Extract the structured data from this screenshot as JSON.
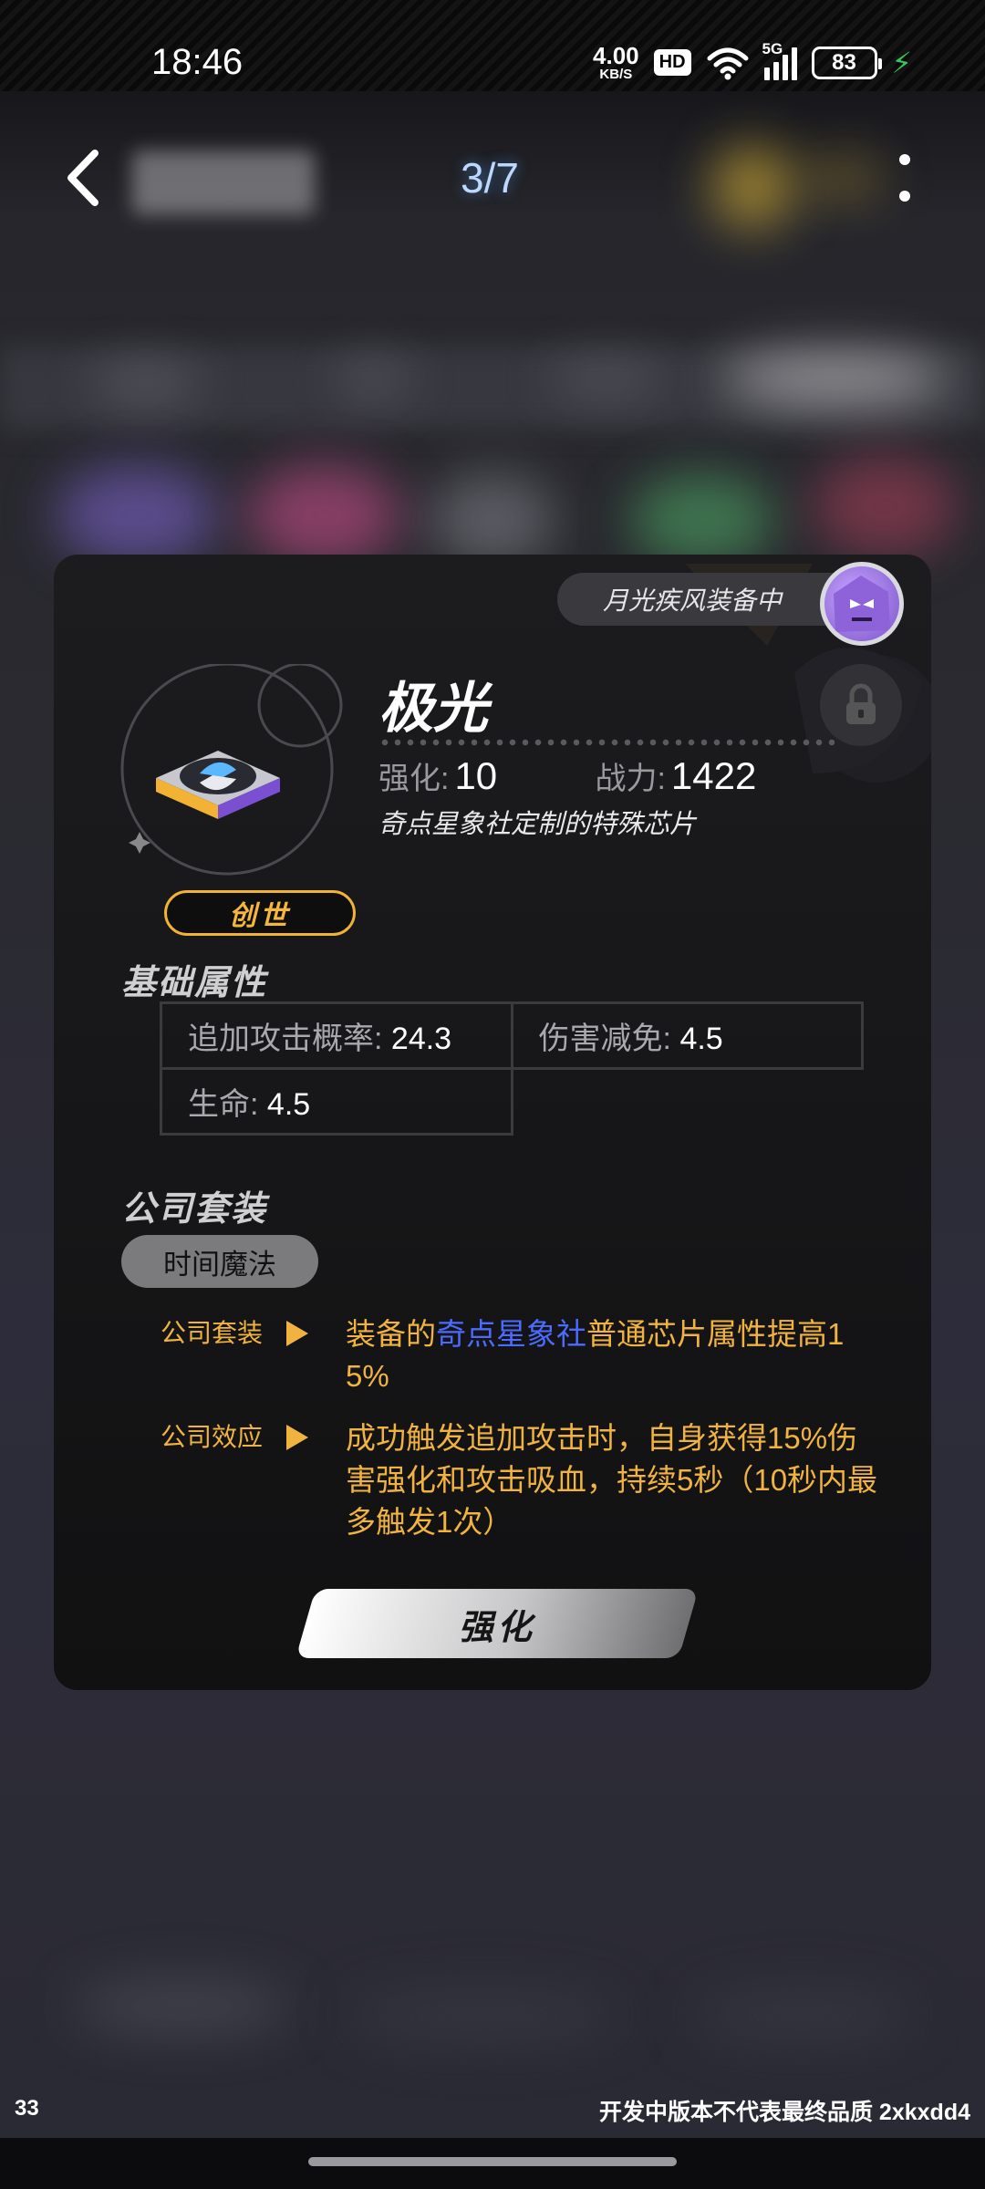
{
  "status_bar": {
    "time": "18:46",
    "net_speed_value": "4.00",
    "net_speed_unit": "KB/S",
    "hd_label": "HD",
    "signal_label": "5G",
    "battery": "83"
  },
  "header": {
    "pager": "3/7"
  },
  "card": {
    "equipped_by": "月光疾风装备中",
    "chip_name": "极光",
    "rarity": "创世",
    "stats": {
      "enhance_label": "强化:",
      "enhance_value": "10",
      "power_label": "战力:",
      "power_value": "1422"
    },
    "description": "奇点星象社定制的特殊芯片",
    "base_attrs_title": "基础属性",
    "base_attrs": [
      {
        "label": "追加攻击概率:",
        "value": "24.3"
      },
      {
        "label": "伤害减免:",
        "value": "4.5"
      },
      {
        "label": "生命:",
        "value": "4.5"
      }
    ],
    "set_title": "公司套装",
    "set_name": "时间魔法",
    "effects": [
      {
        "label": "公司套装",
        "text_before": "装备的",
        "highlight": "奇点星象社",
        "text_after": "普通芯片属性提高15%"
      },
      {
        "label": "公司效应",
        "text": "成功触发追加攻击时，自身获得15%伤害强化和攻击吸血，持续5秒（10秒内最多触发1次）"
      }
    ],
    "enhance_button": "强化"
  },
  "footer": {
    "fps": "33",
    "watermark": "开发中版本不代表最终品质 2xkxdd4"
  },
  "colors": {
    "accent_gold": "#f1b340",
    "highlight_blue": "#4b6bff",
    "card_bg": "#161618"
  }
}
